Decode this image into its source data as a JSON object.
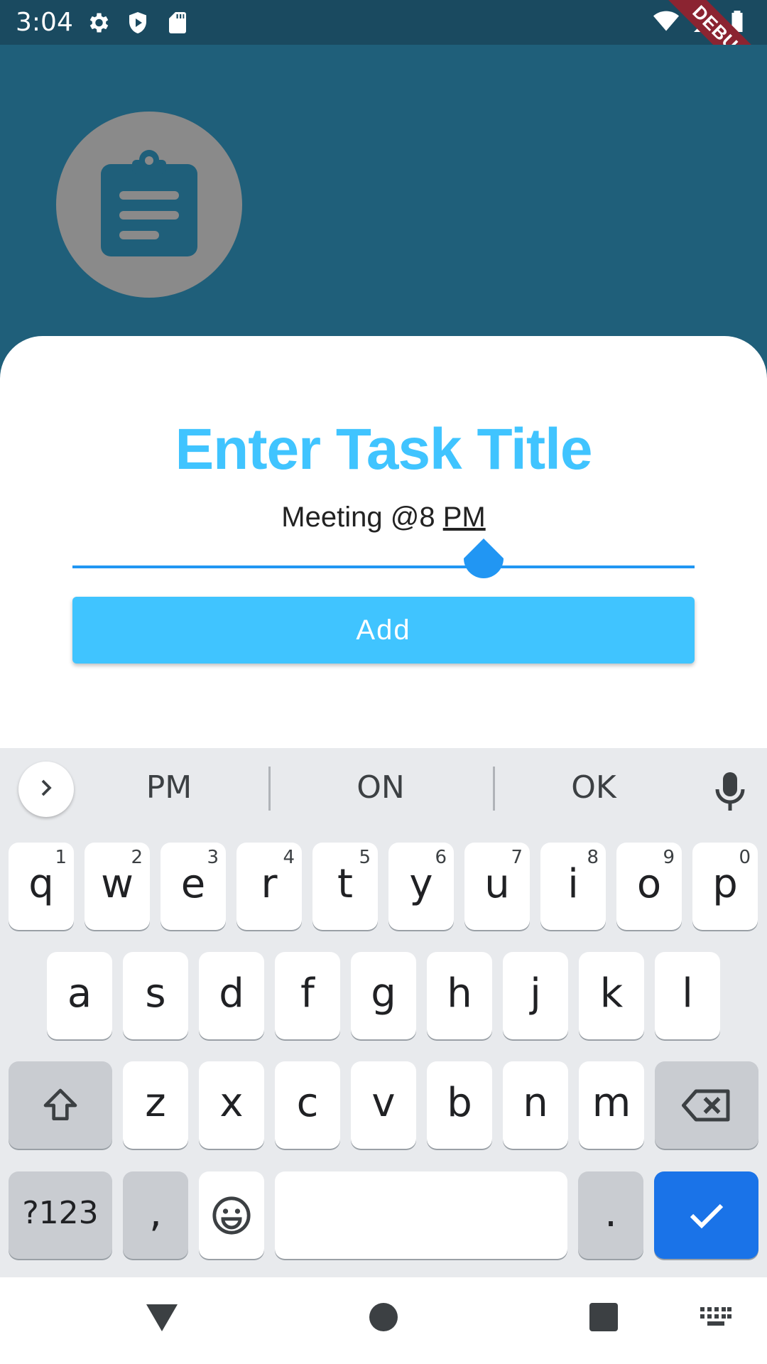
{
  "status_bar": {
    "time": "3:04",
    "left_icons": [
      "gear-icon",
      "shield-icon",
      "sd-card-icon"
    ],
    "right_icons": [
      "wifi-icon",
      "signal-icon",
      "battery-icon"
    ],
    "debug_banner": "DEBUG"
  },
  "header": {
    "avatar_icon": "clipboard-icon",
    "avatar_color": "#8a8a8a",
    "background_color": "#1f5f7a"
  },
  "sheet": {
    "title": "Enter Task Title",
    "input_value_prefix": "Meeting @8 ",
    "input_value_underlined": "PM",
    "add_button_label": "Add",
    "accent_color": "#40c4ff"
  },
  "keyboard": {
    "suggestions": [
      "PM",
      "ON",
      "OK"
    ],
    "row1": [
      {
        "key": "q",
        "hint": "1"
      },
      {
        "key": "w",
        "hint": "2"
      },
      {
        "key": "e",
        "hint": "3"
      },
      {
        "key": "r",
        "hint": "4"
      },
      {
        "key": "t",
        "hint": "5"
      },
      {
        "key": "y",
        "hint": "6"
      },
      {
        "key": "u",
        "hint": "7"
      },
      {
        "key": "i",
        "hint": "8"
      },
      {
        "key": "o",
        "hint": "9"
      },
      {
        "key": "p",
        "hint": "0"
      }
    ],
    "row2": [
      "a",
      "s",
      "d",
      "f",
      "g",
      "h",
      "j",
      "k",
      "l"
    ],
    "row3": [
      "z",
      "x",
      "c",
      "v",
      "b",
      "n",
      "m"
    ],
    "symbols_label": "?123",
    "comma_label": ",",
    "period_label": ".",
    "enter_color": "#1a73e8"
  },
  "navbar": {
    "icons": [
      "back-icon",
      "home-icon",
      "recents-icon",
      "keyboard-switch-icon"
    ]
  }
}
